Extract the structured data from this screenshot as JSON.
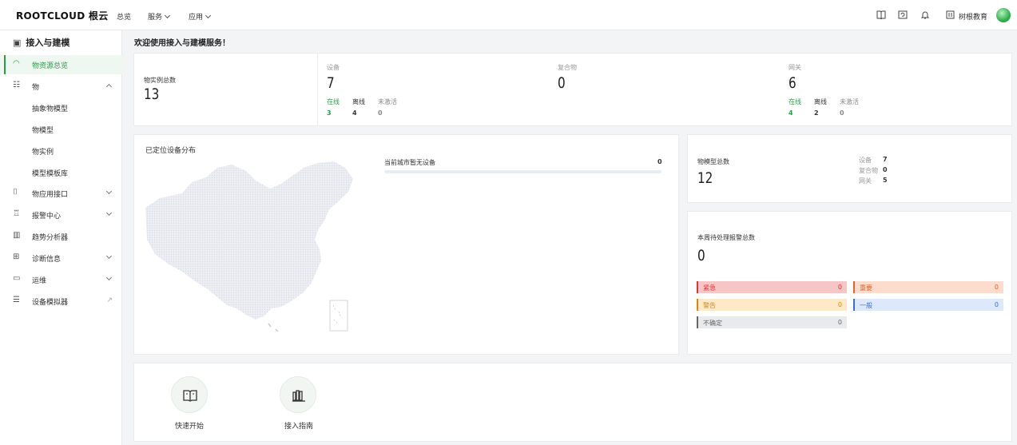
{
  "header": {
    "logo": "ROOTCLOUD 根云",
    "nav": [
      {
        "label": "总览"
      },
      {
        "label": "服务"
      },
      {
        "label": "应用"
      }
    ],
    "org_name": "树根教育"
  },
  "sidebar": {
    "title": "接入与建模",
    "items": [
      {
        "label": "物资源总览",
        "icon": "dashboard-icon"
      },
      {
        "label": "物",
        "icon": "server-icon"
      },
      {
        "label": "物应用接口",
        "icon": "api-icon"
      },
      {
        "label": "报警中心",
        "icon": "alarm-icon"
      },
      {
        "label": "趋势分析器",
        "icon": "chart-icon"
      },
      {
        "label": "诊断信息",
        "icon": "diagnose-icon"
      },
      {
        "label": "运维",
        "icon": "monitor-icon"
      },
      {
        "label": "设备模拟器",
        "icon": "simulator-icon"
      }
    ],
    "sub_items": [
      "抽象物模型",
      "物模型",
      "物实例",
      "模型模板库"
    ]
  },
  "main": {
    "welcome": "欢迎使用接入与建模服务！",
    "instances": {
      "label": "物实例总数",
      "value": "13"
    },
    "device": {
      "label": "设备",
      "value": "7",
      "online_label": "在线",
      "offline_label": "离线",
      "inactive_label": "未激活",
      "online": "3",
      "offline": "4",
      "inactive": "0"
    },
    "composite": {
      "label": "复合物",
      "value": "0"
    },
    "gateway": {
      "label": "网关",
      "value": "6",
      "online_label": "在线",
      "offline_label": "离线",
      "inactive_label": "未激活",
      "online": "4",
      "offline": "2",
      "inactive": "0"
    },
    "map": {
      "title": "已定位设备分布",
      "city_label": "当前城市暂无设备",
      "city_value": "0"
    },
    "models": {
      "label": "物模型总数",
      "value": "12",
      "rows": [
        {
          "label": "设备",
          "value": "7"
        },
        {
          "label": "复合物",
          "value": "0"
        },
        {
          "label": "网关",
          "value": "5"
        }
      ]
    },
    "alarms": {
      "title": "本周待处理报警总数",
      "value": "0",
      "levels": [
        {
          "label": "紧急",
          "value": "0",
          "bg": "#f6c6c6",
          "fg": "#d93636"
        },
        {
          "label": "重要",
          "value": "0",
          "bg": "#fbdccd",
          "fg": "#e0662d"
        },
        {
          "label": "警告",
          "value": "0",
          "bg": "#fde9c7",
          "fg": "#d58a12"
        },
        {
          "label": "一般",
          "value": "0",
          "bg": "#dde8fb",
          "fg": "#3b6fd6"
        },
        {
          "label": "不确定",
          "value": "0",
          "bg": "#e9eaec",
          "fg": "#666666"
        }
      ]
    },
    "quick": [
      {
        "label": "快速开始"
      },
      {
        "label": "接入指南"
      }
    ]
  },
  "colors": {
    "accent": "#2a9d49"
  }
}
